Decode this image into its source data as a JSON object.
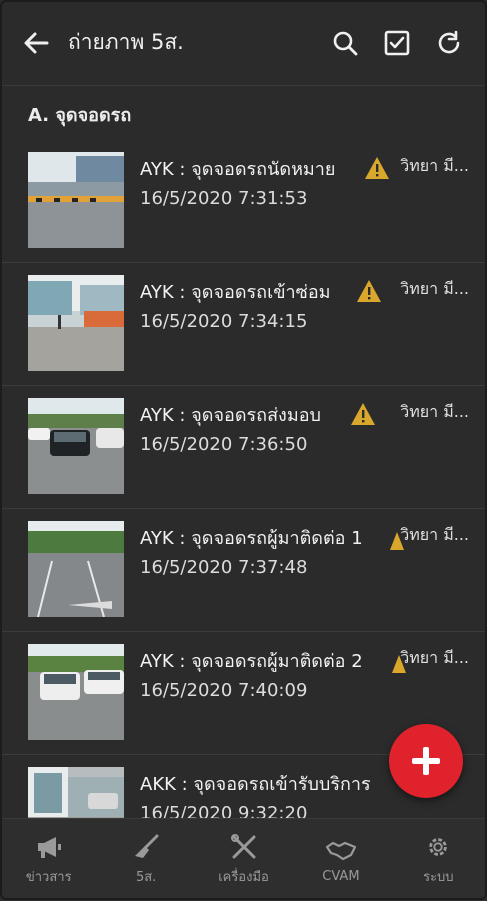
{
  "appbar": {
    "title": "ถ่ายภาพ 5ส.",
    "icons": [
      "back-arrow-icon",
      "search-icon",
      "checkbox-icon",
      "refresh-icon"
    ]
  },
  "section": {
    "title": "A. จุดจอดรถ"
  },
  "items": [
    {
      "title": "AYK : จุดจอดรถนัดหมาย",
      "time": "16/5/2020 7:31:53",
      "user": "วิทยา มี...",
      "thumb": "parking-entrance-photo"
    },
    {
      "title": "AYK : จุดจอดรถเข้าซ่อม",
      "time": "16/5/2020 7:34:15",
      "user": "วิทยา มี...",
      "thumb": "service-entrance-photo"
    },
    {
      "title": "AYK : จุดจอดรถส่งมอบ",
      "time": "16/5/2020 7:36:50",
      "user": "วิทยา มี...",
      "thumb": "delivery-parking-photo"
    },
    {
      "title": "AYK : จุดจอดรถผู้มาติดต่อ 1",
      "time": "16/5/2020 7:37:48",
      "user": "วิทยา มี...",
      "thumb": "visitor-parking-1-photo"
    },
    {
      "title": "AYK : จุดจอดรถผู้มาติดต่อ 2",
      "time": "16/5/2020 7:40:09",
      "user": "วิทยา มี...",
      "thumb": "visitor-parking-2-photo"
    },
    {
      "title": "AKK : จุดจอดรถเข้ารับบริการ",
      "time": "16/5/2020 9:32:20",
      "user": "",
      "thumb": "service-parking-photo"
    }
  ],
  "fab": {
    "icon": "plus-icon"
  },
  "bottom_nav": [
    {
      "label": "ข่าวสาร",
      "icon": "megaphone-icon"
    },
    {
      "label": "5ส.",
      "icon": "broom-icon"
    },
    {
      "label": "เครื่องมือ",
      "icon": "tools-icon"
    },
    {
      "label": "CVAM",
      "icon": "handshake-icon"
    },
    {
      "label": "ระบบ",
      "icon": "gear-icon"
    }
  ],
  "colors": {
    "background": "#2b2b2b",
    "fab": "#e0222c",
    "warning": "#d9a72c"
  }
}
